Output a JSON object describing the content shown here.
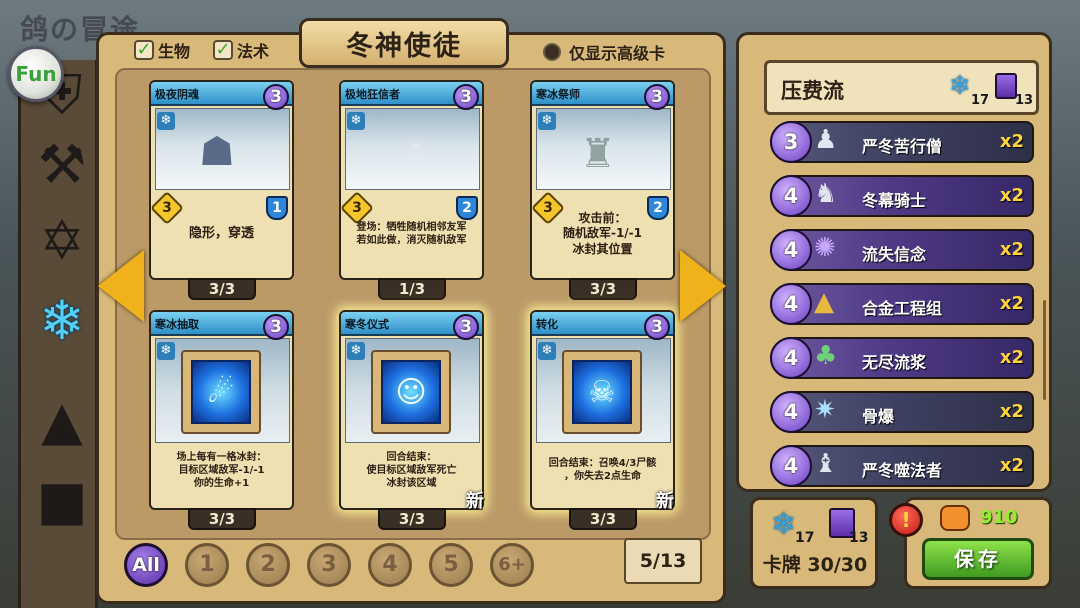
{
  "background_title": "鸽の冒途",
  "fun_button": "Fun",
  "filters": {
    "creature_label": "生物",
    "spell_label": "法术",
    "high_level_label": "仅显示高级卡"
  },
  "title": "冬神使徒",
  "categories": [
    "shield-icon",
    "axe-icon",
    "hexagram-icon",
    "snowflake-icon",
    "hat-icon",
    "book-icon"
  ],
  "cards": [
    {
      "name": "极夜阴魂",
      "cost": "3",
      "attack": "3",
      "health": "1",
      "desc": "隐形，穿透",
      "count": "3/3"
    },
    {
      "name": "极地狂信者",
      "cost": "3",
      "attack": "3",
      "health": "2",
      "desc": "登场：牺牲随机相邻友军\n若如此做，消灭随机敌军",
      "count": "1/3"
    },
    {
      "name": "寒冰祭师",
      "cost": "3",
      "attack": "3",
      "health": "2",
      "desc": "攻击前：\n随机敌军-1/-1\n冰封其位置",
      "count": "3/3"
    },
    {
      "name": "寒冰抽取",
      "cost": "3",
      "desc": "场上每有一格冰封：\n目标区域敌军-1/-1\n你的生命+1",
      "count": "3/3"
    },
    {
      "name": "寒冬仪式",
      "cost": "3",
      "desc": "回合结束：\n使目标区域敌军死亡\n冰封该区域",
      "count": "3/3",
      "new": "新"
    },
    {
      "name": "转化",
      "cost": "3",
      "desc": "回合结束：召唤4/3尸骸\n，你失去2点生命",
      "count": "3/3",
      "new": "新"
    }
  ],
  "cost_filters": [
    "All",
    "1",
    "2",
    "3",
    "4",
    "5",
    "6+"
  ],
  "page": "5/13",
  "deck": {
    "name": "压费流",
    "snow_count": "17",
    "book_count": "13",
    "cards": [
      {
        "cost": "3",
        "name": "严冬苦行僧",
        "count": "x2"
      },
      {
        "cost": "4",
        "name": "冬幕骑士",
        "count": "x2"
      },
      {
        "cost": "4",
        "name": "流失信念",
        "count": "x2"
      },
      {
        "cost": "4",
        "name": "合金工程组",
        "count": "x2"
      },
      {
        "cost": "4",
        "name": "无尽流浆",
        "count": "x2"
      },
      {
        "cost": "4",
        "name": "骨爆",
        "count": "x2"
      },
      {
        "cost": "4",
        "name": "严冬噬法者",
        "count": "x2"
      }
    ]
  },
  "stats": {
    "snow_count": "17",
    "book_count": "13",
    "card_count": "卡牌 30/30"
  },
  "currency": "910",
  "save_label": "保存",
  "warning_glyph": "!",
  "colors": {
    "accent": "#f0b21a",
    "deck_cost": "#6b3fc2",
    "save": "#3f9b20",
    "count": "#ffd43a"
  }
}
